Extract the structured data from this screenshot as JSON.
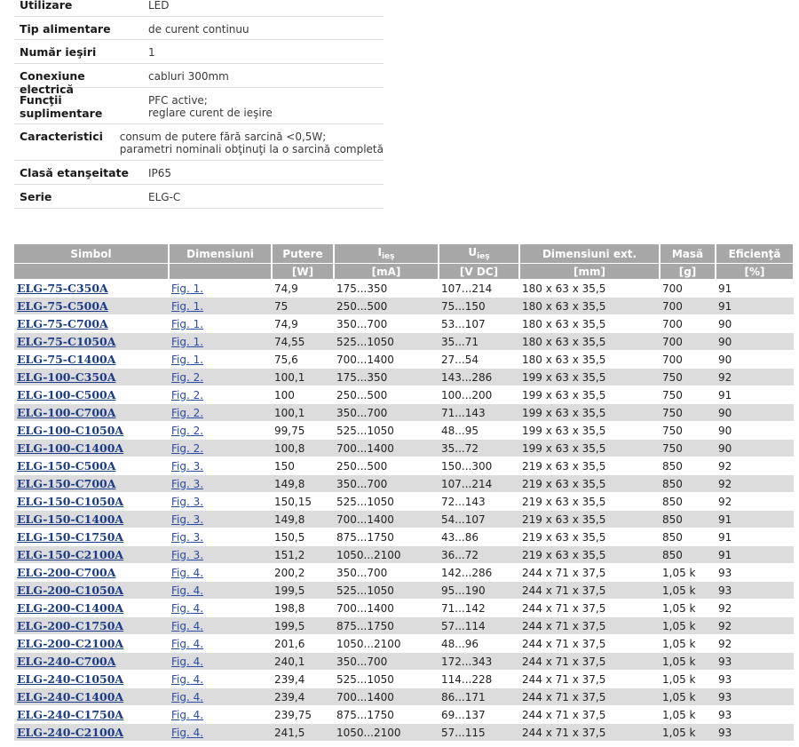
{
  "specs": [
    {
      "label": "Utilizare",
      "value": [
        "LED"
      ]
    },
    {
      "label": "Tip alimentare",
      "value": [
        "de curent continuu"
      ]
    },
    {
      "label": "Număr ieşiri",
      "value": [
        "1"
      ]
    },
    {
      "label": "Conexiune electrică",
      "value": [
        "cabluri 300mm"
      ]
    },
    {
      "label": "Funcţii suplimentare",
      "value": [
        "PFC active;",
        "reglare curent de ieşire"
      ]
    },
    {
      "label": "Caracteristici",
      "value": [
        "consum de putere fără sarcină <0,5W;",
        "parametri nominali obţinuţi la o sarcină completă"
      ]
    },
    {
      "label": "Clasă etanşeitate",
      "value": [
        "IP65"
      ]
    },
    {
      "label": "Serie",
      "value": [
        "ELG-C"
      ]
    }
  ],
  "table": {
    "headers": [
      "Simbol",
      "Dimensiuni",
      "Putere",
      "I",
      "U",
      "Dimensiuni ext.",
      "Masă",
      "Eficienţă"
    ],
    "header_subscripts": {
      "I": "ieş",
      "U": "ieş"
    },
    "units": [
      "",
      "",
      "[W]",
      "[mA]",
      "[V DC]",
      "[mm]",
      "[g]",
      "[%]"
    ],
    "rows": [
      [
        "ELG-75-C350A",
        "Fig. 1.",
        "74,9",
        "175...350",
        "107...214",
        "180 x 63 x 35,5",
        "700",
        "91"
      ],
      [
        "ELG-75-C500A",
        "Fig. 1.",
        "75",
        "250...500",
        "75...150",
        "180 x 63 x 35,5",
        "700",
        "91"
      ],
      [
        "ELG-75-C700A",
        "Fig. 1.",
        "74,9",
        "350...700",
        "53...107",
        "180 x 63 x 35,5",
        "700",
        "90"
      ],
      [
        "ELG-75-C1050A",
        "Fig. 1.",
        "74,55",
        "525...1050",
        "35...71",
        "180 x 63 x 35,5",
        "700",
        "90"
      ],
      [
        "ELG-75-C1400A",
        "Fig. 1.",
        "75,6",
        "700...1400",
        "27...54",
        "180 x 63 x 35,5",
        "700",
        "90"
      ],
      [
        "ELG-100-C350A",
        "Fig. 2.",
        "100,1",
        "175...350",
        "143...286",
        "199 x 63 x 35,5",
        "750",
        "92"
      ],
      [
        "ELG-100-C500A",
        "Fig. 2.",
        "100",
        "250...500",
        "100...200",
        "199 x 63 x 35,5",
        "750",
        "91"
      ],
      [
        "ELG-100-C700A",
        "Fig. 2.",
        "100,1",
        "350...700",
        "71...143",
        "199 x 63 x 35,5",
        "750",
        "90"
      ],
      [
        "ELG-100-C1050A",
        "Fig. 2.",
        "99,75",
        "525...1050",
        "48...95",
        "199 x 63 x 35,5",
        "750",
        "90"
      ],
      [
        "ELG-100-C1400A",
        "Fig. 2.",
        "100,8",
        "700...1400",
        "35...72",
        "199 x 63 x 35,5",
        "750",
        "90"
      ],
      [
        "ELG-150-C500A",
        "Fig. 3.",
        "150",
        "250...500",
        "150...300",
        "219 x 63 x 35,5",
        "850",
        "92"
      ],
      [
        "ELG-150-C700A",
        "Fig. 3.",
        "149,8",
        "350...700",
        "107...214",
        "219 x 63 x 35,5",
        "850",
        "92"
      ],
      [
        "ELG-150-C1050A",
        "Fig. 3.",
        "150,15",
        "525...1050",
        "72...143",
        "219 x 63 x 35,5",
        "850",
        "92"
      ],
      [
        "ELG-150-C1400A",
        "Fig. 3.",
        "149,8",
        "700...1400",
        "54...107",
        "219 x 63 x 35,5",
        "850",
        "91"
      ],
      [
        "ELG-150-C1750A",
        "Fig. 3.",
        "150,5",
        "875...1750",
        "43...86",
        "219 x 63 x 35,5",
        "850",
        "91"
      ],
      [
        "ELG-150-C2100A",
        "Fig. 3.",
        "151,2",
        "1050...2100",
        "36...72",
        "219 x 63 x 35,5",
        "850",
        "91"
      ],
      [
        "ELG-200-C700A",
        "Fig. 4.",
        "200,2",
        "350...700",
        "142...286",
        "244 x 71 x 37,5",
        "1,05 k",
        "93"
      ],
      [
        "ELG-200-C1050A",
        "Fig. 4.",
        "199,5",
        "525...1050",
        "95...190",
        "244 x 71 x 37,5",
        "1,05 k",
        "93"
      ],
      [
        "ELG-200-C1400A",
        "Fig. 4.",
        "198,8",
        "700...1400",
        "71...142",
        "244 x 71 x 37,5",
        "1,05 k",
        "92"
      ],
      [
        "ELG-200-C1750A",
        "Fig. 4.",
        "199,5",
        "875...1750",
        "57...114",
        "244 x 71 x 37,5",
        "1,05 k",
        "92"
      ],
      [
        "ELG-200-C2100A",
        "Fig. 4.",
        "201,6",
        "1050...2100",
        "48...96",
        "244 x 71 x 37,5",
        "1,05 k",
        "92"
      ],
      [
        "ELG-240-C700A",
        "Fig. 4.",
        "240,1",
        "350...700",
        "172...343",
        "244 x 71 x 37,5",
        "1,05 k",
        "93"
      ],
      [
        "ELG-240-C1050A",
        "Fig. 4.",
        "239,4",
        "525...1050",
        "114...228",
        "244 x 71 x 37,5",
        "1,05 k",
        "93"
      ],
      [
        "ELG-240-C1400A",
        "Fig. 4.",
        "239,4",
        "700...1400",
        "86...171",
        "244 x 71 x 37,5",
        "1,05 k",
        "93"
      ],
      [
        "ELG-240-C1750A",
        "Fig. 4.",
        "239,75",
        "875...1750",
        "69...137",
        "244 x 71 x 37,5",
        "1,05 k",
        "93"
      ],
      [
        "ELG-240-C2100A",
        "Fig. 4.",
        "241,5",
        "1050...2100",
        "57...115",
        "244 x 71 x 37,5",
        "1,05 k",
        "93"
      ]
    ]
  }
}
